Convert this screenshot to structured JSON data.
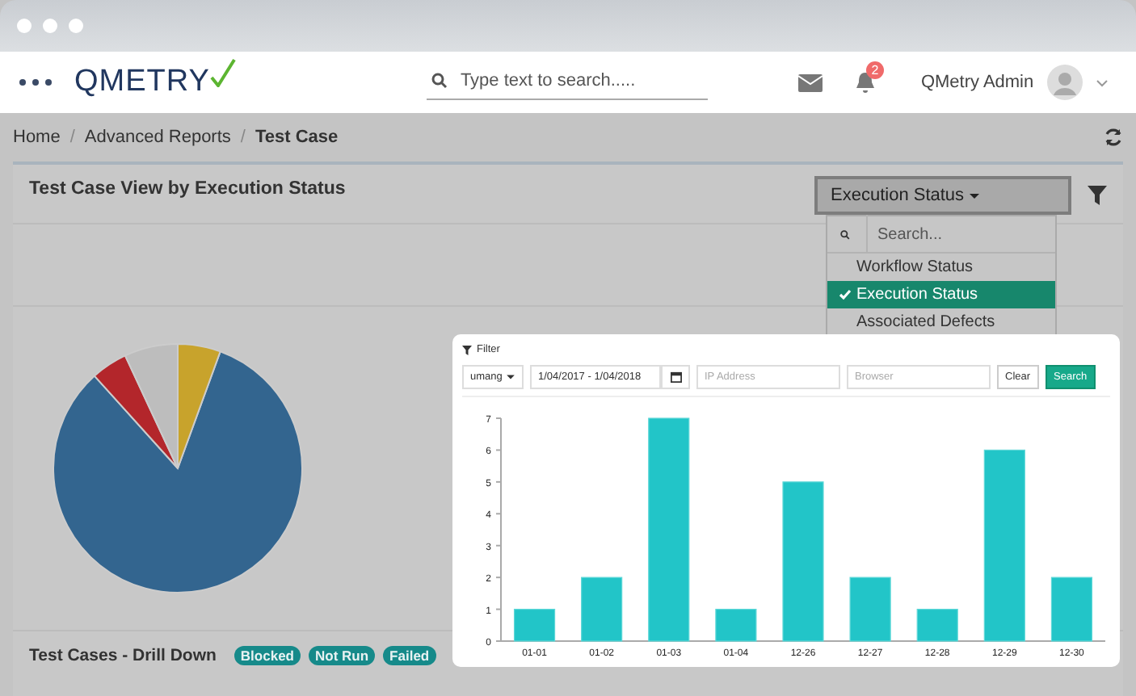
{
  "header": {
    "logo": "QMETRY",
    "search": {
      "placeholder": "Type text to search....."
    },
    "notifications": {
      "count": "2"
    },
    "user": {
      "name": "QMetry Admin"
    }
  },
  "breadcrumb": [
    {
      "label": "Home",
      "current": false,
      "separator": "/"
    },
    {
      "label": "Advanced Reports",
      "current": false,
      "separator": "/"
    },
    {
      "label": "Test Case",
      "current": true
    }
  ],
  "panel": {
    "title": "Test Case View by Execution Status",
    "view_select": {
      "value": "Execution Status",
      "expanded": true
    },
    "menu": {
      "search_placeholder": "Search...",
      "items": [
        {
          "label": "Workflow Status",
          "selected": false
        },
        {
          "label": "Execution Status",
          "selected": true
        },
        {
          "label": "Associated Defects",
          "selected": false
        }
      ]
    }
  },
  "drill_down": {
    "title": "Test Cases - Drill Down",
    "tags": [
      "Blocked",
      "Not Run",
      "Failed"
    ]
  },
  "popup": {
    "filter_label": "Filter",
    "user_select": "umang",
    "date_range": "1/04/2017 - 1/04/2018",
    "ip_placeholder": "IP Address",
    "browser_placeholder": "Browser",
    "buttons": [
      "Clear",
      "Search"
    ],
    "chart_data": {
      "type": "bar",
      "categories": [
        "01-01",
        "01-02",
        "01-03",
        "01-04",
        "12-26",
        "12-27",
        "12-28",
        "12-29",
        "12-30"
      ],
      "series": [
        {
          "color": "#22c5c8",
          "values": [
            1,
            2,
            7,
            1,
            5,
            2,
            1,
            6,
            2
          ]
        }
      ],
      "ylim": [
        0,
        7
      ],
      "yticks": [
        0,
        1,
        2,
        3,
        4,
        5,
        6,
        7
      ]
    }
  }
}
